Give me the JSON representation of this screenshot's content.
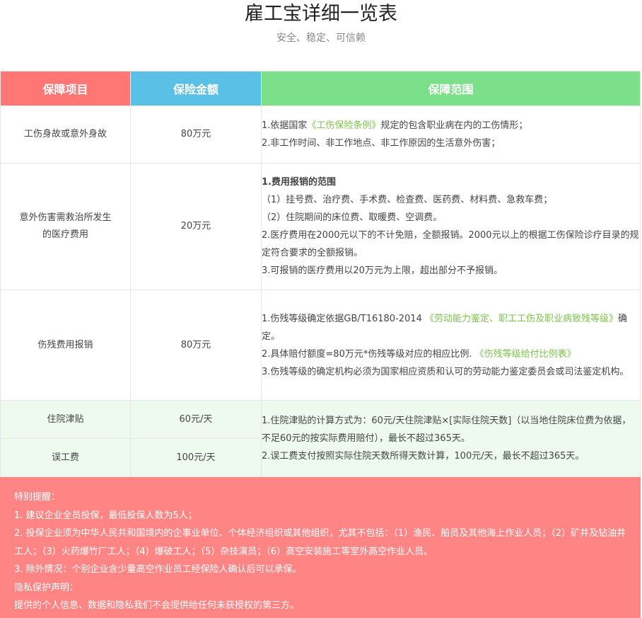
{
  "header": {
    "title": "雇工宝详细一览表",
    "subtitle": "安全、稳定、可信赖"
  },
  "table": {
    "columns": [
      "保障项目",
      "保险金额",
      "保障范围"
    ],
    "rows": [
      {
        "item": "工伤身故或意外身故",
        "amount": "80万元",
        "lines": [
          {
            "a": "1.依据国家",
            "g": "《工伤保险条例》",
            "b": "规定的包含职业病在内的工伤情形；"
          },
          {
            "a": "2.非工作时间、非工作地点、非工作原因的生活意外伤害；"
          }
        ]
      },
      {
        "item_line1": "意外伤害需救治所发生",
        "item_line2": "的医疗费用",
        "amount": "20万元",
        "lines": [
          {
            "a": "1.费用报销的范围"
          },
          {
            "a": "（1）挂号费、治疗费、手术费、检查费、医药费、材料费、急救车费；"
          },
          {
            "a": "（2）住院期间的床位费、取暖费、空调费。"
          },
          {
            "a": "2.医疗费用在2000元以下的不计免赔，全额报销。2000元以上的根据工伤保险诊疗目录的规定符合要求的全额报销。"
          },
          {
            "a": "3.可报销的医疗费用以20万元为上限，超出部分不予报销。"
          }
        ]
      },
      {
        "item": "伤残费用报销",
        "amount": "80万元",
        "lines": [
          {
            "a": "1.伤残等级确定依据GB/T16180-2014 ",
            "g": "《劳动能力鉴定、职工工伤及职业病致残等级》",
            "b": "确定。"
          },
          {
            "a": "2.具体赔付额度=80万元*伤残等级对应的相应比例. ",
            "g": "《伤残等级给付比例表》"
          },
          {
            "a": "3.伤残等级的确定机构必须为国家相应资质和认可的劳动能力鉴定委员会或司法鉴定机构。"
          }
        ]
      },
      {
        "item": "住院津贴",
        "amount": "60元/天",
        "lines": [
          {
            "a": "1.住院津贴的计算方式为：60元/天住院津贴×[实际住院天数]（以当地住院床位费为依据，不足60元的按实际费用赔付），最长不超过365天。"
          },
          {
            "a": "2.误工费支付按照实际住院天数所得天数计算，100元/天，最长不超过365天。"
          }
        ]
      },
      {
        "item": "误工费",
        "amount": "100元/天"
      }
    ]
  },
  "notice": {
    "lines": [
      "特别提醒：",
      "1. 建议企业全员投保，最低投保人数为5人；",
      "2. 投保企业须为中华人民共和国境内的企事业单位、个体经济组织或其他组织，尤其不包括：（1）渔民、船员及其他海上作业人员；（2）矿井及钻油井工人；（3）火药爆竹厂工人；（4）爆破工人；（5）杂技演员；（6）高空安装施工等室外高空作业人员。",
      "3. 除外情况：个别企业含少量高空作业员工经保险人确认后可以承保。",
      "隐私保护声明：",
      "提供的个人信息、数据和隐私我们不会提供给任何未获授权的第三方。"
    ]
  },
  "colors": {
    "col1_header": "#ff7675",
    "col2_header": "#5bc0e6",
    "col3_header": "#7ce08a",
    "highlight_text": "#7cc34a",
    "notice_bg": "#ff8585",
    "light_row_bg": "#eefaee"
  }
}
